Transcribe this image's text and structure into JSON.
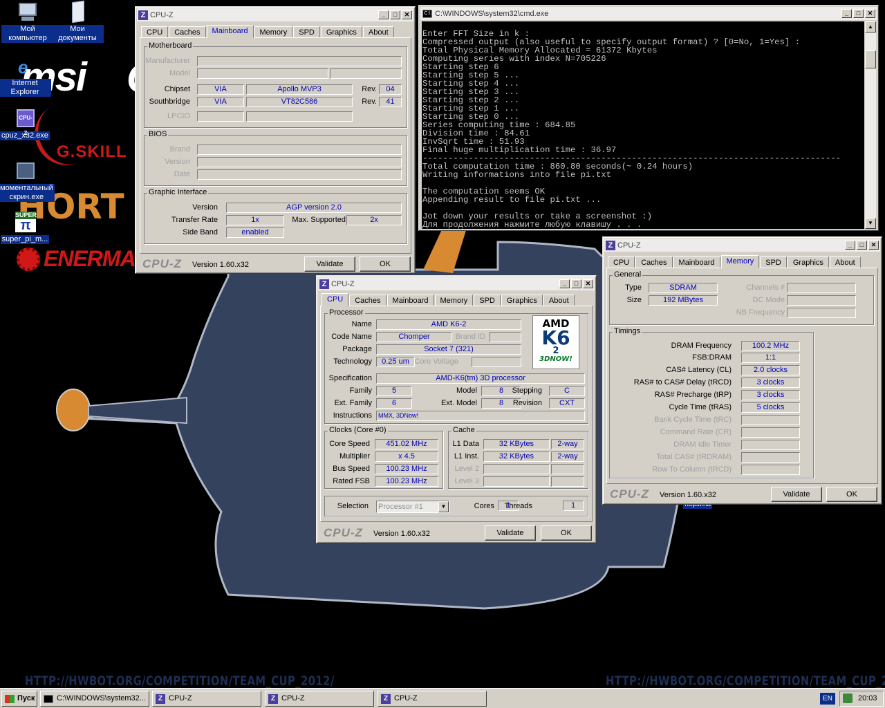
{
  "desktop": {
    "urls": [
      "HTTP://HWBOT.ORG/COMPETITION/TEAM_CUP_2012/",
      "HTTP://HWBOT.ORG/COMPETITION/TEAM_CUP_2012/"
    ],
    "logos": {
      "msi": "msi",
      "msi_tail": "C",
      "gskill": "G.SKILL",
      "short": "HORT",
      "enermax": "ENERMAX"
    },
    "icons": [
      {
        "label": "Мой компьютер",
        "icon": "my-computer-icon"
      },
      {
        "label": "Мои документы",
        "icon": "my-documents-icon"
      },
      {
        "label": "Internet Explorer",
        "icon": "internet-explorer-icon"
      },
      {
        "label": "cpuz_x32.exe",
        "icon": "cpuz-icon"
      },
      {
        "label": "моментальный скрин.exe",
        "icon": "screenshot-app-icon"
      },
      {
        "label": "super_pi_m...",
        "icon": "superpi-icon"
      }
    ],
    "partial_icon_label": "Корзина"
  },
  "cmd": {
    "title": "C:\\WINDOWS\\system32\\cmd.exe",
    "lines": [
      "Enter FFT Size in k :",
      "Compressed output (also useful to specify output format) ? [0=No, 1=Yes] :",
      "Total Physical Memory Allocated = 61372 Kbytes",
      "Computing series with index N=705226",
      "Starting step 6",
      "Starting step 5 ...",
      "Starting step 4 ...",
      "Starting step 3 ...",
      "Starting step 2 ...",
      "Starting step 1 ...",
      "Starting step 0 ...",
      "Series computing time : 684.85",
      "Division time : 84.61",
      "InvSqrt time : 51.93",
      "Final huge multiplication time : 36.97",
      "----------------------------------------------------------------------------------",
      "Total computation time : 860.80 seconds(~ 0.24 hours)",
      "Writing informations into file pi.txt",
      "",
      "The computation seems OK",
      "Appending result to file pi.txt ...",
      "",
      "Jot down your results or take a screenshot :)",
      "Для продолжения нажмите любую клавишу . . ."
    ]
  },
  "cpuz_common": {
    "title": "CPU-Z",
    "tabs": [
      "CPU",
      "Caches",
      "Mainboard",
      "Memory",
      "SPD",
      "Graphics",
      "About"
    ],
    "logo": "CPU-Z",
    "version": "Version 1.60.x32",
    "validate": "Validate",
    "ok": "OK"
  },
  "mainboard": {
    "motherboard_group": "Motherboard",
    "manufacturer_label": "Manufacturer",
    "model_label": "Model",
    "chipset_label": "Chipset",
    "chipset_vendor": "VIA",
    "chipset_name": "Apollo MVP3",
    "rev_label": "Rev.",
    "chipset_rev": "04",
    "southbridge_label": "Southbridge",
    "southbridge_vendor": "VIA",
    "southbridge_name": "VT82C586",
    "southbridge_rev": "41",
    "lpcio_label": "LPCIO",
    "bios_group": "BIOS",
    "brand_label": "Brand",
    "version_label": "Version",
    "date_label": "Date",
    "graphic_group": "Graphic Interface",
    "gi_version_label": "Version",
    "gi_version": "AGP version 2.0",
    "transfer_label": "Transfer Rate",
    "transfer": "1x",
    "max_label": "Max. Supported",
    "max": "2x",
    "sideband_label": "Side Band",
    "sideband": "enabled"
  },
  "cpu": {
    "processor_group": "Processor",
    "name_label": "Name",
    "name": "AMD K6-2",
    "codename_label": "Code Name",
    "codename": "Chomper",
    "brandid_label": "Brand ID",
    "package_label": "Package",
    "package": "Socket 7 (321)",
    "tech_label": "Technology",
    "tech": "0.25 um",
    "corevolt_label": "Core Voltage",
    "spec_label": "Specification",
    "spec": "AMD-K6(tm) 3D processor",
    "family_label": "Family",
    "family": "5",
    "model_label": "Model",
    "model": "8",
    "stepping_label": "Stepping",
    "stepping": "C",
    "extfamily_label": "Ext. Family",
    "extfamily": "6",
    "extmodel_label": "Ext. Model",
    "extmodel": "8",
    "revision_label": "Revision",
    "revision": "CXT",
    "instr_label": "Instructions",
    "instr": "MMX, 3DNow!",
    "amd_logo": {
      "amd": "AMD",
      "k6": "K6",
      "two": "2",
      "tag": "3DNOW!"
    },
    "clocks_group": "Clocks (Core #0)",
    "corespeed_label": "Core Speed",
    "corespeed": "451.02 MHz",
    "mult_label": "Multiplier",
    "mult": "x 4.5",
    "bus_label": "Bus Speed",
    "bus": "100.23 MHz",
    "fsb_label": "Rated FSB",
    "fsb": "100.23 MHz",
    "cache_group": "Cache",
    "l1d_label": "L1 Data",
    "l1d": "32 KBytes",
    "l1d_way": "2-way",
    "l1i_label": "L1 Inst.",
    "l1i": "32 KBytes",
    "l1i_way": "2-way",
    "l2_label": "Level 2",
    "l3_label": "Level 3",
    "selection_label": "Selection",
    "selection": "Processor #1",
    "cores_label": "Cores",
    "cores": "1",
    "threads_label": "Threads",
    "threads": "1"
  },
  "memory": {
    "general_group": "General",
    "type_label": "Type",
    "type": "SDRAM",
    "size_label": "Size",
    "size": "192 MBytes",
    "channels_label": "Channels #",
    "dcmode_label": "DC Mode",
    "nbfreq_label": "NB Frequency",
    "timings_group": "Timings",
    "dram_label": "DRAM Frequency",
    "dram": "100.2 MHz",
    "fsbdram_label": "FSB:DRAM",
    "fsbdram": "1:1",
    "cas_label": "CAS# Latency (CL)",
    "cas": "2.0 clocks",
    "trcd_label": "RAS# to CAS# Delay (tRCD)",
    "trcd": "3 clocks",
    "trp_label": "RAS# Precharge (tRP)",
    "trp": "3 clocks",
    "tras_label": "Cycle Time (tRAS)",
    "tras": "5 clocks",
    "trc_label": "Bank Cycle Time (tRC)",
    "cr_label": "Command Rate (CR)",
    "idle_label": "DRAM Idle Timer",
    "total_label": "Total CAS# (tRDRAM)",
    "rtc_label": "Row To Column (tRCD)"
  },
  "taskbar": {
    "start": "Пуск",
    "items": [
      "C:\\WINDOWS\\system32...",
      "CPU-Z",
      "CPU-Z",
      "CPU-Z"
    ],
    "lang": "EN",
    "clock": "20:03"
  }
}
